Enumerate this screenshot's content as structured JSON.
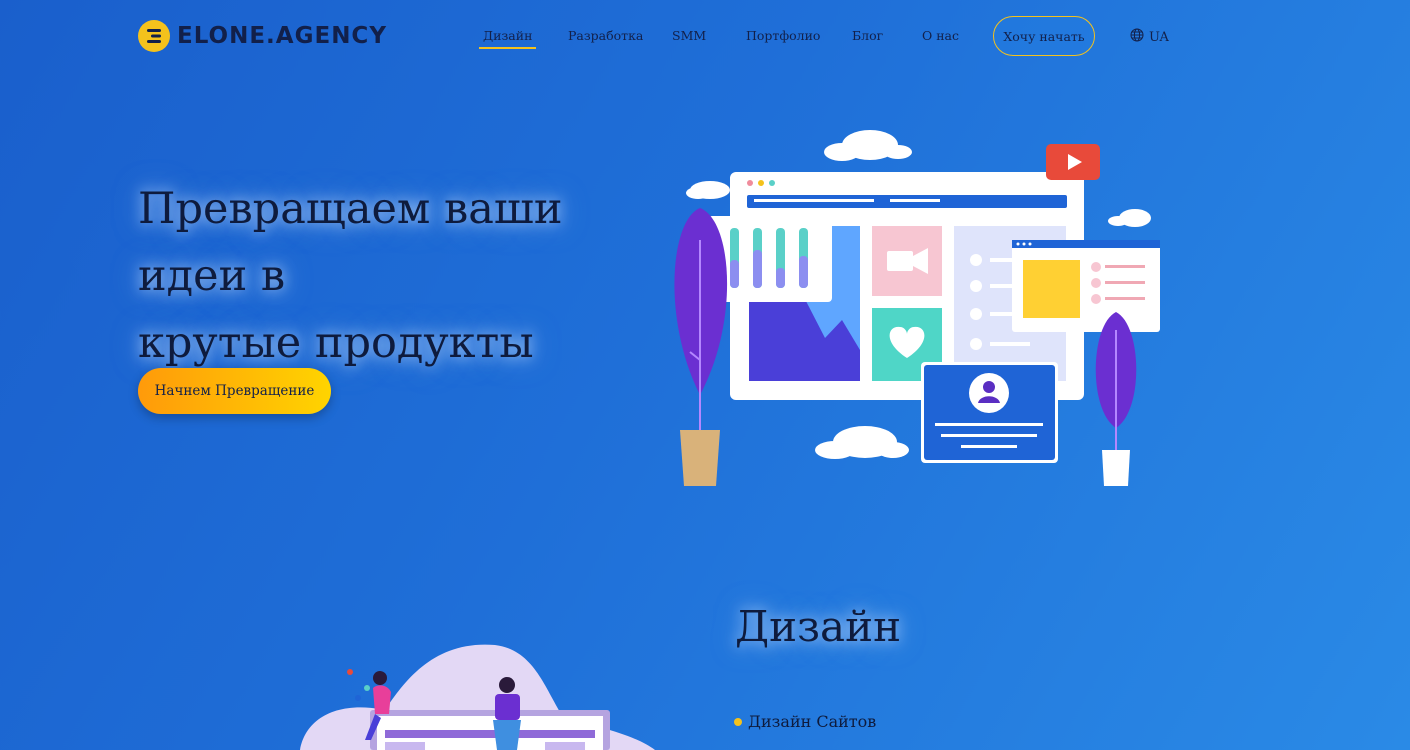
{
  "brand": {
    "name": "ELONE.AGENCY",
    "accent": "#f4c21c"
  },
  "nav": {
    "items": [
      {
        "label": "Дизайн",
        "active": true
      },
      {
        "label": "Разработка",
        "active": false
      },
      {
        "label": "SMM",
        "active": false
      },
      {
        "label": "Портфолио",
        "active": false
      },
      {
        "label": "Блог",
        "active": false
      },
      {
        "label": "О нас",
        "active": false
      }
    ],
    "cta_label": "Хочу начать",
    "language": "UA",
    "language_icon": "globe-icon"
  },
  "hero": {
    "title_line1": "Превращаем ваши идеи в",
    "title_line2": "крутые продукты",
    "button_label": "Начнем Превращение"
  },
  "section": {
    "title": "Дизайн",
    "services": [
      "Дизайн Сайтов"
    ]
  }
}
